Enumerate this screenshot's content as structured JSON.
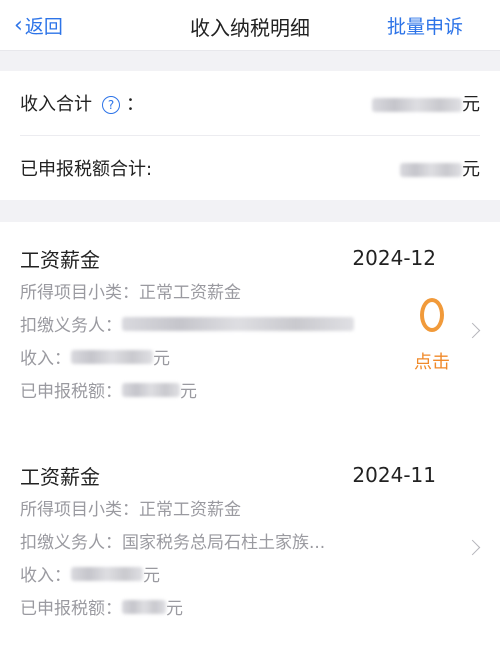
{
  "topbar": {
    "back_label": "返回",
    "title": "收入纳税明细",
    "action_label": "批量申诉"
  },
  "summary": {
    "income_total_label": "收入合计",
    "income_total_suffix": "：",
    "income_total_value_unit": "元",
    "tax_total_label": "已申报税额合计:",
    "tax_total_value_unit": "元"
  },
  "records": [
    {
      "type": "工资薪金",
      "period": "2024-12",
      "subtype_label": "所得项目小类：",
      "subtype_value": "正常工资薪金",
      "payer_label": "扣缴义务人：",
      "payer_value": "",
      "income_label": "收入：",
      "income_unit": "元",
      "tax_label": "已申报税额：",
      "tax_unit": "元",
      "annotation": "点击"
    },
    {
      "type": "工资薪金",
      "period": "2024-11",
      "subtype_label": "所得项目小类：",
      "subtype_value": "正常工资薪金",
      "payer_label": "扣缴义务人：",
      "payer_value": "国家税务总局石柱土家族...",
      "income_label": "收入：",
      "income_unit": "元",
      "tax_label": "已申报税额：",
      "tax_unit": "元"
    }
  ],
  "colors": {
    "accent": "#2d74e8",
    "annotation": "#f08a2a"
  },
  "icons": {
    "back": "chevron-left-icon",
    "help": "question-circle-icon",
    "row_arrow": "chevron-right-icon"
  }
}
